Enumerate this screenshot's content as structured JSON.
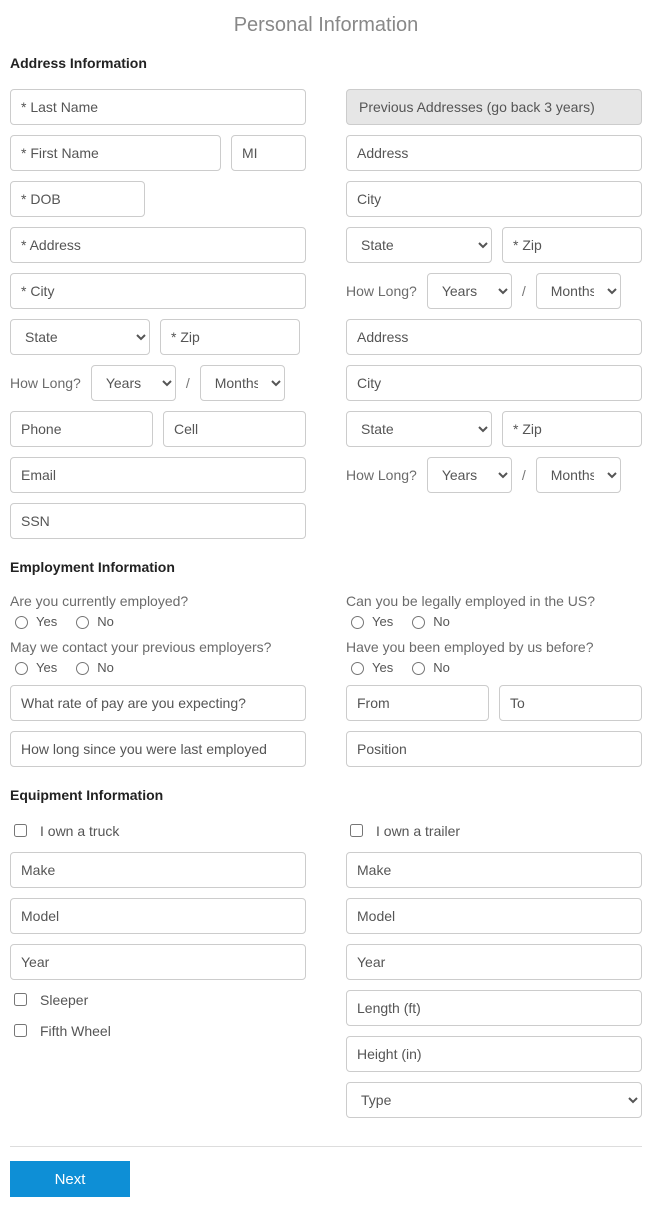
{
  "pageTitle": "Personal Information",
  "sections": {
    "address": "Address Information",
    "employment": "Employment Information",
    "equipment": "Equipment Information"
  },
  "addr": {
    "lastName": "* Last Name",
    "firstName": "* First Name",
    "mi": "MI",
    "dob": "* DOB",
    "address": "* Address",
    "city": "* City",
    "state": "State",
    "zip": "* Zip",
    "howLong": "How Long?",
    "years": "Years",
    "months": "Months",
    "slash": "/",
    "phone": "Phone",
    "cell": "Cell",
    "email": "Email",
    "ssn": "SSN"
  },
  "prev": {
    "header": "Previous Addresses (go back 3 years)",
    "address": "Address",
    "city": "City",
    "state": "State",
    "zip": "* Zip",
    "howLong": "How Long?",
    "years": "Years",
    "months": "Months"
  },
  "emp": {
    "q1": "Are you currently employed?",
    "q2": "May we contact your previous employers?",
    "q3": "Can you be legally employed in the US?",
    "q4": "Have you been employed by us before?",
    "yes": "Yes",
    "no": "No",
    "rate": "What rate of pay are you expecting?",
    "since": "How long since you were last employed",
    "from": "From",
    "to": "To",
    "position": "Position"
  },
  "equip": {
    "ownTruck": "I own a truck",
    "ownTrailer": "I own a trailer",
    "make": "Make",
    "model": "Model",
    "year": "Year",
    "sleeper": "Sleeper",
    "fifthWheel": "Fifth Wheel",
    "length": "Length (ft)",
    "height": "Height (in)",
    "type": "Type"
  },
  "next": "Next"
}
